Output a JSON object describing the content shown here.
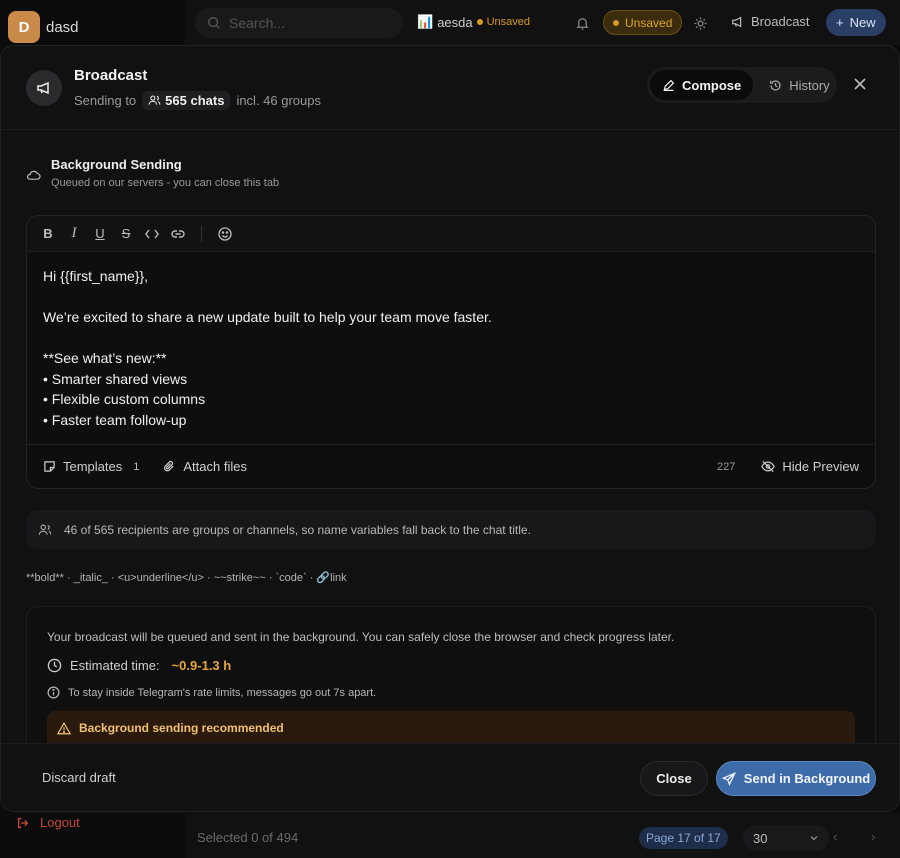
{
  "workspace": {
    "initial": "D",
    "name": "dasd",
    "avatar_color": "#c98a4a"
  },
  "sidebar": {
    "logout_label": "Logout"
  },
  "topbar": {
    "search_placeholder": "Search...",
    "file_icon": "📊",
    "file_name": "aesda",
    "file_status": "Unsaved",
    "unsaved_pill": "Unsaved",
    "broadcast_label": "Broadcast",
    "new_label": "New"
  },
  "footer": {
    "selected_text": "Selected 0 of 494",
    "page_text": "Page 17 of 17",
    "per_page": "30"
  },
  "modal": {
    "title": "Broadcast",
    "sending_to": "Sending to",
    "chats_count": "565 chats",
    "groups_note": "incl. 46 groups",
    "tabs": [
      {
        "label": "Compose",
        "active": true
      },
      {
        "label": "History",
        "active": false
      }
    ],
    "background_title": "Background Sending",
    "background_sub": "Queued on our servers - you can close this tab",
    "editor": {
      "lines": [
        "Hi {{first_name}},",
        "",
        "We’re excited to share a new update built to help your team move faster.",
        "",
        "**See what’s new:**",
        "• Smarter shared views",
        "• Flexible custom columns",
        "• Faster team follow-up"
      ],
      "templates_label": "Templates",
      "templates_count": "1",
      "attach_label": "Attach files",
      "char_count": "227",
      "hide_preview_label": "Hide Preview"
    },
    "recipients_notice": "46 of 565 recipients are groups or channels, so name variables fall back to the chat title.",
    "format_hint": "**bold** · _italic_ · <u>underline</u> · ~~strike~~ · `code` · 🔗link",
    "info": {
      "description": "Your broadcast will be queued and sent in the background. You can safely close the browser and check progress later.",
      "estimated_label": "Estimated time:",
      "estimated_value": "~0.9-1.3 h",
      "rate_note": "To stay inside Telegram's rate limits, messages go out 7s apart.",
      "warning_title": "Background sending recommended"
    },
    "discard_label": "Discard draft",
    "close_label": "Close",
    "send_label": "Send in Background"
  },
  "colors": {
    "accent": "#3d6aa8",
    "warning": "#e6a73a",
    "danger": "#c4453b"
  }
}
